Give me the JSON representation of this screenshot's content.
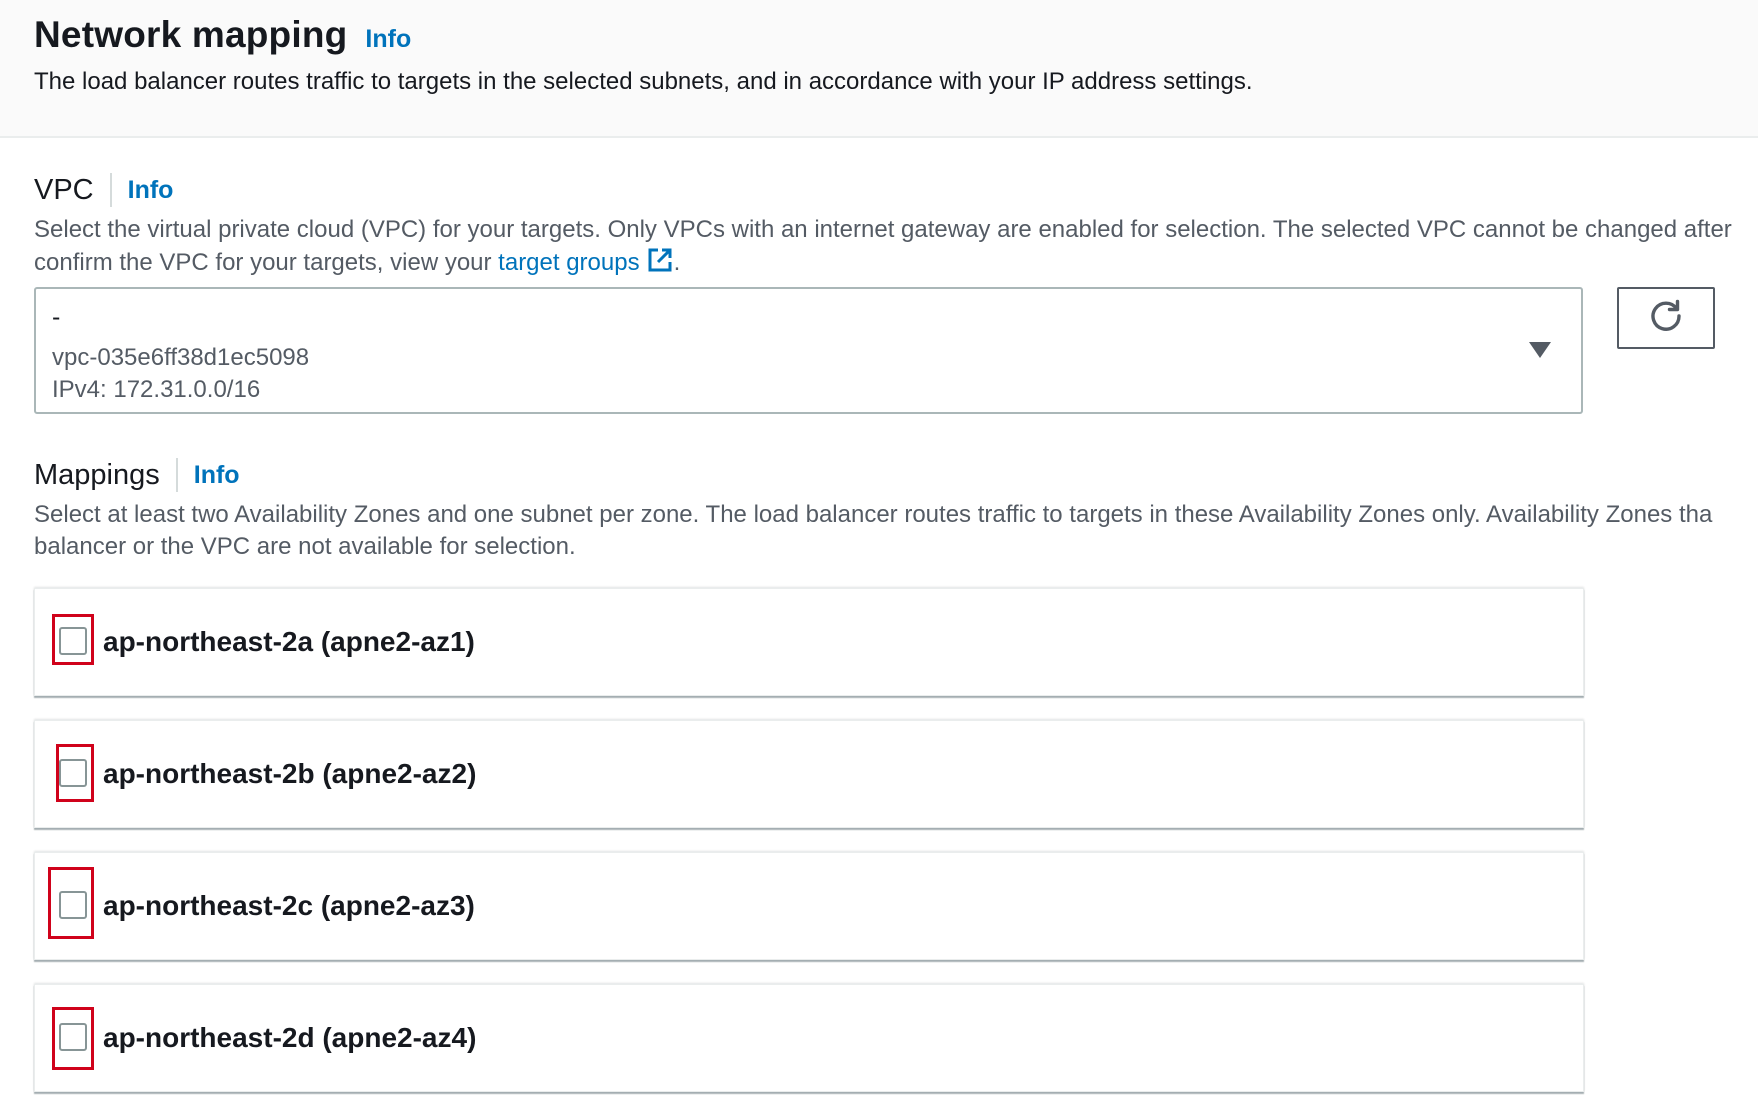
{
  "header": {
    "title": "Network mapping",
    "info": "Info",
    "description": "The load balancer routes traffic to targets in the selected subnets, and in accordance with your IP address settings."
  },
  "vpc": {
    "label": "VPC",
    "info": "Info",
    "description_line1": "Select the virtual private cloud (VPC) for your targets. Only VPCs with an internet gateway are enabled for selection. The selected VPC cannot be changed after",
    "description_line2_prefix": "confirm the VPC for your targets, view your ",
    "description_link": "target groups",
    "description_suffix": ".",
    "selected": {
      "name": "-",
      "id": "vpc-035e6ff38d1ec5098",
      "cidr": "IPv4: 172.31.0.0/16"
    },
    "icons": {
      "external_link": "external-link-icon",
      "caret": "caret-down-icon",
      "refresh": "refresh-icon"
    }
  },
  "mappings": {
    "label": "Mappings",
    "info": "Info",
    "description_line1": "Select at least two Availability Zones and one subnet per zone. The load balancer routes traffic to targets in these Availability Zones only. Availability Zones tha",
    "description_line2": "balancer or the VPC are not available for selection.",
    "zones": [
      {
        "label": "ap-northeast-2a (apne2-az1)",
        "checked": false
      },
      {
        "label": "ap-northeast-2b (apne2-az2)",
        "checked": false
      },
      {
        "label": "ap-northeast-2c (apne2-az3)",
        "checked": false
      },
      {
        "label": "ap-northeast-2d (apne2-az4)",
        "checked": false
      }
    ]
  },
  "colors": {
    "link": "#0073bb",
    "highlight": "#d0021b",
    "text": "#16191f",
    "secondary_text": "#545b64"
  }
}
